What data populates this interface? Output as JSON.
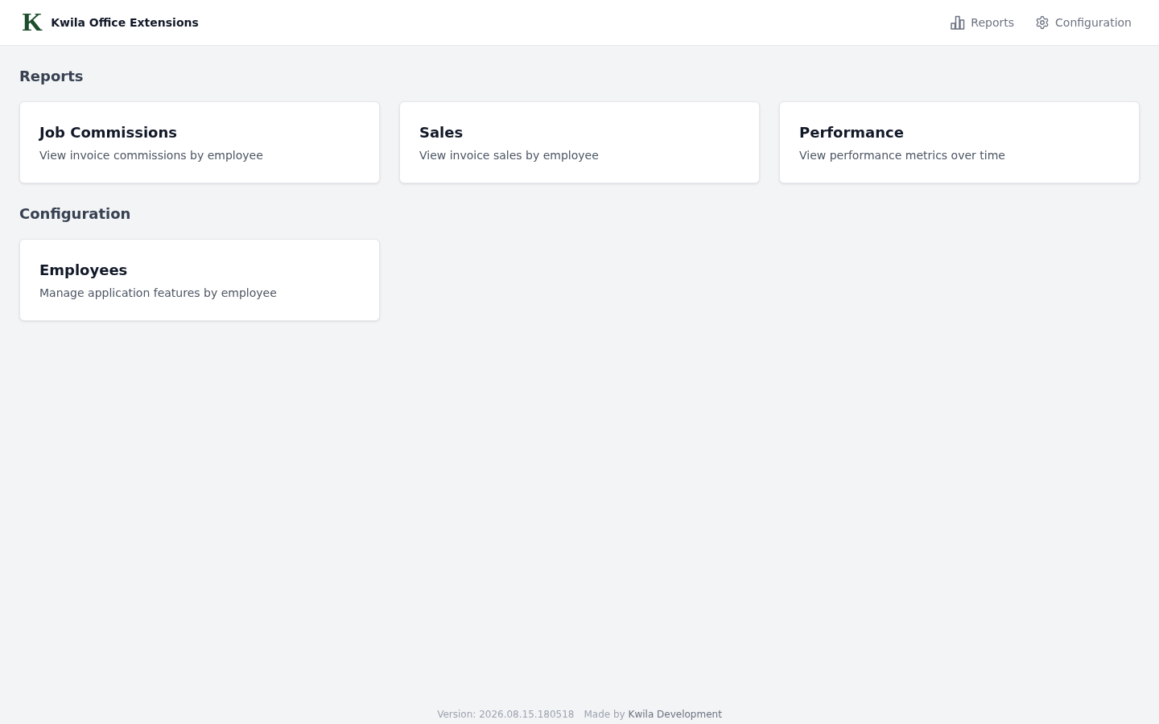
{
  "header": {
    "logo_letter": "K",
    "title": "Kwila Office Extensions",
    "nav": [
      {
        "kind": "reports",
        "label": "Reports"
      },
      {
        "kind": "configuration",
        "label": "Configuration"
      }
    ]
  },
  "sections": [
    {
      "heading": "Reports",
      "cards": [
        {
          "title": "Job Commissions",
          "description": "View invoice commissions by employee"
        },
        {
          "title": "Sales",
          "description": "View invoice sales by employee"
        },
        {
          "title": "Performance",
          "description": "View performance metrics over time"
        }
      ]
    },
    {
      "heading": "Configuration",
      "cards": [
        {
          "title": "Employees",
          "description": "Manage application features by employee"
        }
      ]
    }
  ],
  "footer": {
    "version": "Version: 2026.08.15.180518",
    "made_by": "Made by",
    "link": "Kwila Development"
  }
}
